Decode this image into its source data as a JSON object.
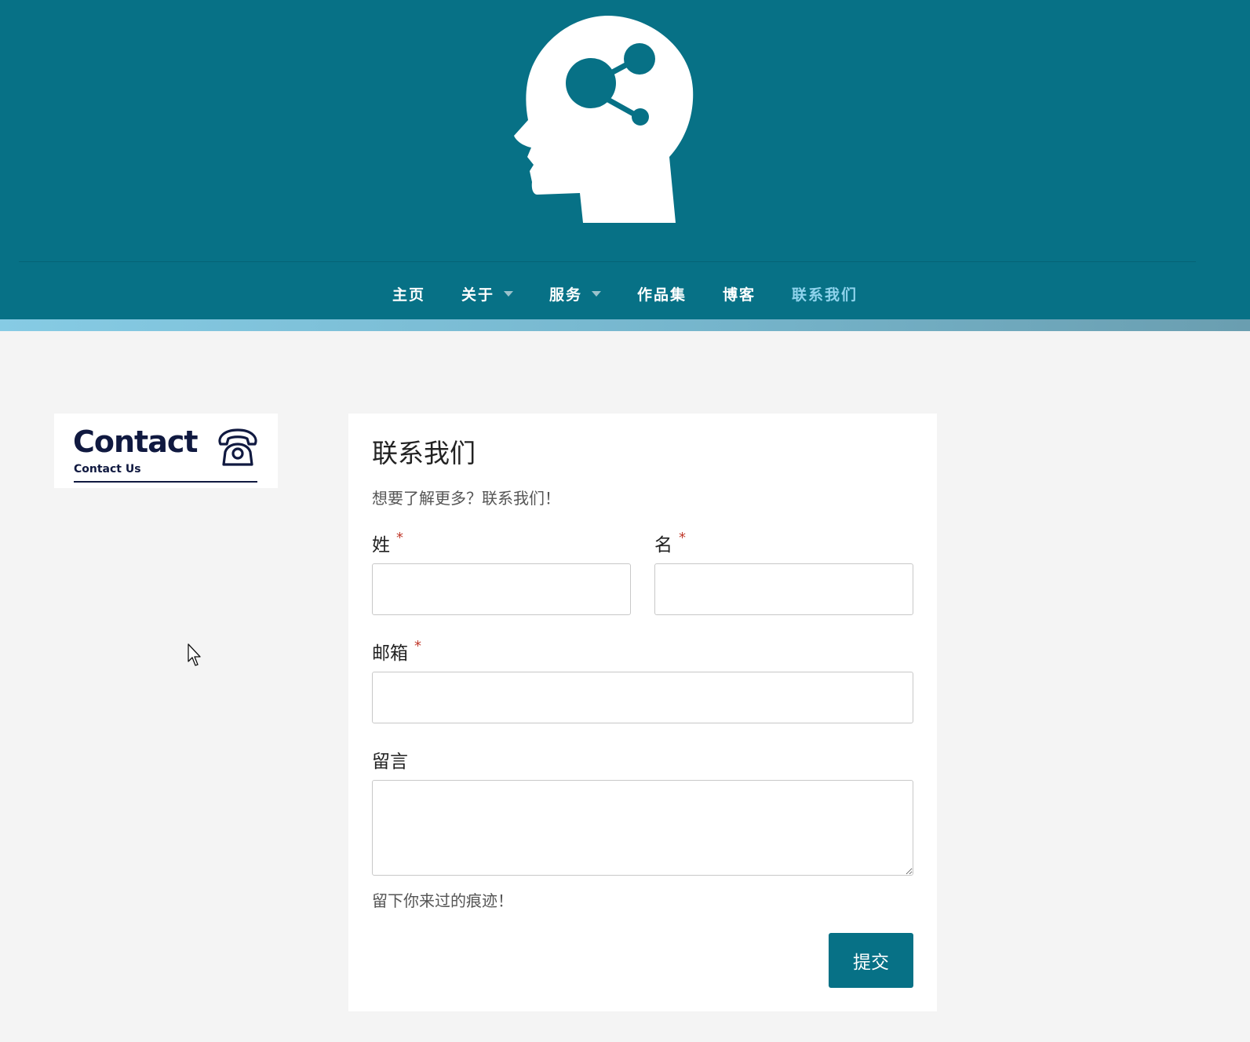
{
  "nav": {
    "items": [
      {
        "label": "主页",
        "has_dropdown": false,
        "active": false
      },
      {
        "label": "关于",
        "has_dropdown": true,
        "active": false
      },
      {
        "label": "服务",
        "has_dropdown": true,
        "active": false
      },
      {
        "label": "作品集",
        "has_dropdown": false,
        "active": false
      },
      {
        "label": "博客",
        "has_dropdown": false,
        "active": false
      },
      {
        "label": "联系我们",
        "has_dropdown": false,
        "active": true
      }
    ]
  },
  "logo": {
    "icon": "head-network-icon"
  },
  "contact_badge": {
    "title": "Contact",
    "subtitle": "Contact Us",
    "icon": "telephone-icon"
  },
  "form": {
    "title": "联系我们",
    "subtitle": "想要了解更多？联系我们！",
    "required_mark": "*",
    "last_name_label": "姓",
    "last_name_value": "",
    "first_name_label": "名",
    "first_name_value": "",
    "email_label": "邮箱",
    "email_value": "",
    "message_label": "留言",
    "message_value": "",
    "help_text": "留下你来过的痕迹！",
    "submit_label": "提交"
  },
  "colors": {
    "header_bg": "#077186",
    "nav_active": "#8fd3ec",
    "button_bg": "#077186",
    "required_mark": "#c0392b",
    "page_bg": "#f4f4f4"
  }
}
